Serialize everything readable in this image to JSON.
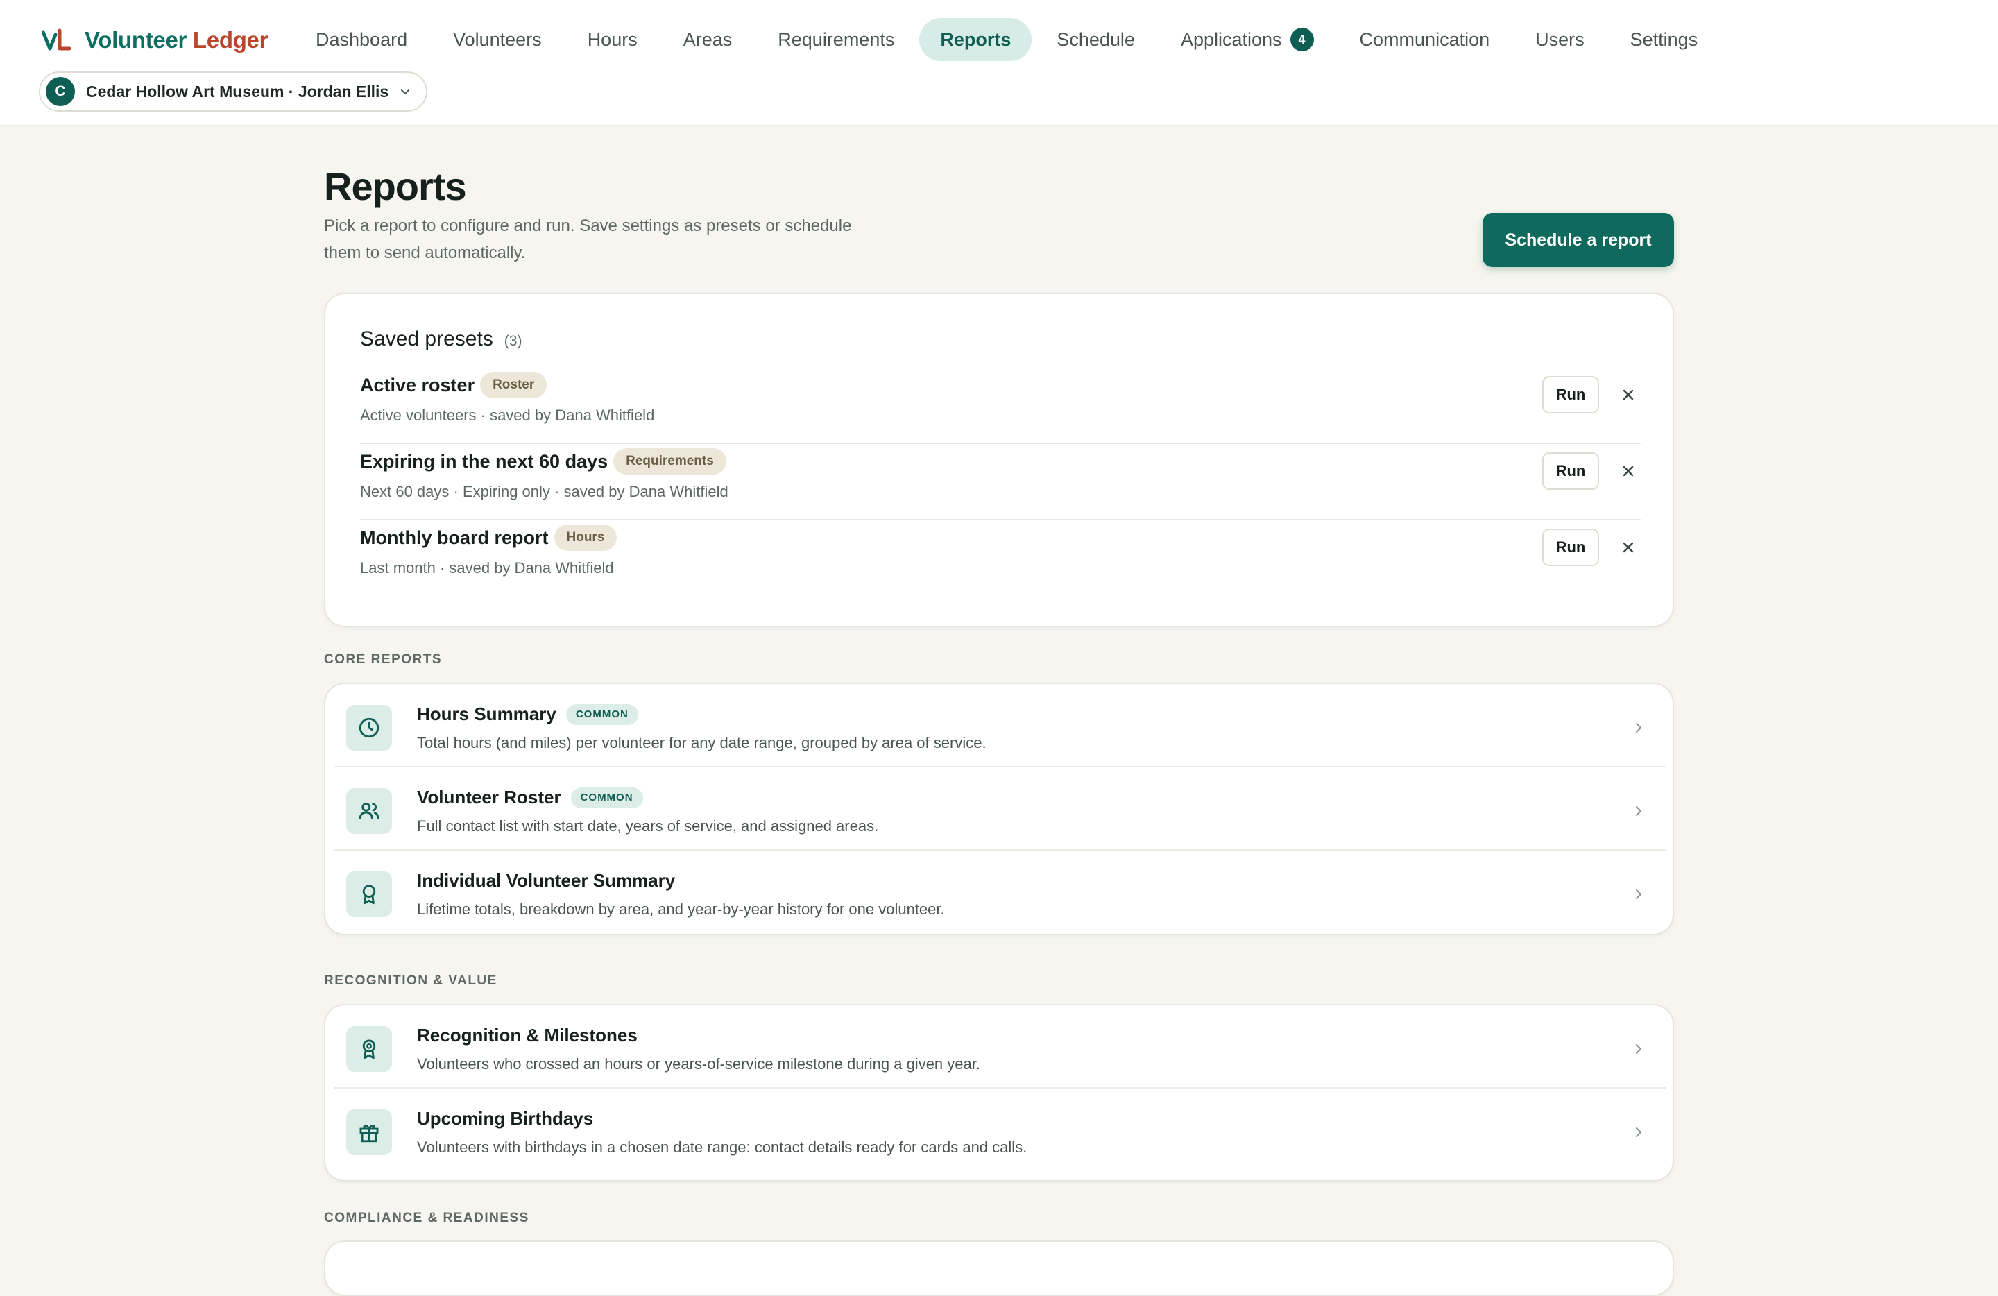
{
  "app": {
    "brand_part1": "Volunteer",
    "brand_part2": "Ledger",
    "colors": {
      "primary": "#0f6a5d",
      "brand_red": "#b9462c",
      "accent_soft": "#d7ece6"
    }
  },
  "nav": {
    "items": [
      {
        "label": "Dashboard"
      },
      {
        "label": "Volunteers"
      },
      {
        "label": "Hours"
      },
      {
        "label": "Areas"
      },
      {
        "label": "Requirements"
      },
      {
        "label": "Reports",
        "active": true
      },
      {
        "label": "Schedule"
      },
      {
        "label": "Applications",
        "badge": "4"
      },
      {
        "label": "Communication"
      },
      {
        "label": "Users"
      },
      {
        "label": "Settings"
      }
    ]
  },
  "org_switcher": {
    "avatar_letter": "C",
    "label": "Cedar Hollow Art Museum · Jordan Ellis",
    "icon": "chevron-down-icon"
  },
  "page": {
    "title": "Reports",
    "subtitle": "Pick a report to configure and run. Save settings as presets or schedule them to send automatically.",
    "primary_action": "Schedule a report"
  },
  "presets": {
    "title": "Saved presets",
    "count": "(3)",
    "run_label": "Run",
    "items": [
      {
        "name": "Active roster",
        "tag": "Roster",
        "meta": "Active volunteers · saved by Dana Whitfield"
      },
      {
        "name": "Expiring in the next 60 days",
        "tag": "Requirements",
        "meta": "Next 60 days · Expiring only · saved by Dana Whitfield"
      },
      {
        "name": "Monthly board report",
        "tag": "Hours",
        "meta": "Last month · saved by Dana Whitfield"
      }
    ]
  },
  "sections": {
    "core": {
      "label": "CORE REPORTS",
      "reports": [
        {
          "title": "Hours Summary",
          "badge": "COMMON",
          "desc": "Total hours (and miles) per volunteer for any date range, grouped by area of service.",
          "icon": "clock-icon"
        },
        {
          "title": "Volunteer Roster",
          "badge": "COMMON",
          "desc": "Full contact list with start date, years of service, and assigned areas.",
          "icon": "users-icon"
        },
        {
          "title": "Individual Volunteer Summary",
          "desc": "Lifetime totals, breakdown by area, and year-by-year history for one volunteer.",
          "icon": "award-icon"
        }
      ]
    },
    "recognition": {
      "label": "RECOGNITION & VALUE",
      "reports": [
        {
          "title": "Recognition & Milestones",
          "desc": "Volunteers who crossed an hours or years-of-service milestone during a given year.",
          "icon": "medal-icon"
        },
        {
          "title": "Upcoming Birthdays",
          "desc": "Volunteers with birthdays in a chosen date range: contact details ready for cards and calls.",
          "icon": "gift-icon"
        }
      ]
    },
    "compliance": {
      "label": "COMPLIANCE & READINESS"
    }
  }
}
